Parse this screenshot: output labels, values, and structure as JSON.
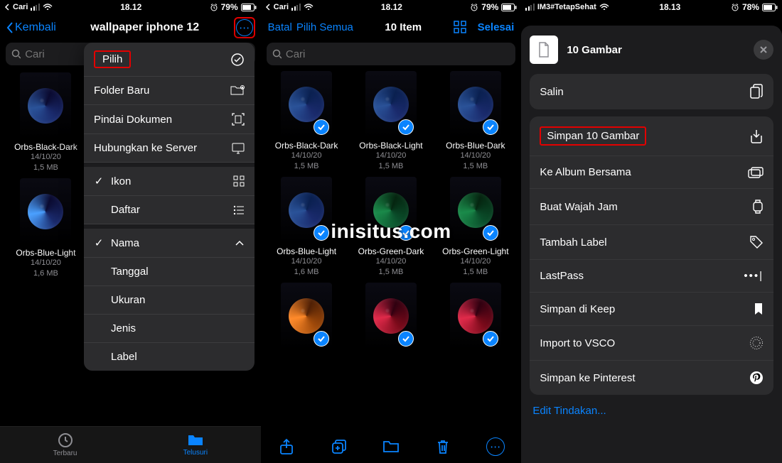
{
  "watermark": "inisitus.com",
  "screen1": {
    "status": {
      "carrier": "Cari",
      "time": "18.12",
      "battery": "79%"
    },
    "nav": {
      "back": "Kembali",
      "title": "wallpaper iphone 12"
    },
    "search": {
      "placeholder": "Cari"
    },
    "dropdown": {
      "select": "Pilih",
      "new_folder": "Folder Baru",
      "scan_doc": "Pindai Dokumen",
      "connect_server": "Hubungkan ke Server",
      "view_icons": "Ikon",
      "view_list": "Daftar",
      "sort_name": "Nama",
      "sort_date": "Tanggal",
      "sort_size": "Ukuran",
      "sort_kind": "Jenis",
      "sort_label": "Label"
    },
    "files": [
      {
        "name": "Orbs-Black-Dark",
        "date": "14/10/20",
        "size": "1,5 MB"
      },
      {
        "name": "Orbs-Blue-Light",
        "date": "14/10/20",
        "size": "1,6 MB"
      }
    ],
    "tabs": {
      "recent": "Terbaru",
      "browse": "Telusuri"
    }
  },
  "screen2": {
    "status": {
      "carrier": "Cari",
      "time": "18.12",
      "battery": "79%"
    },
    "nav": {
      "cancel": "Batal",
      "select_all": "Pilih Semua",
      "count": "10 Item",
      "done": "Selesai"
    },
    "search": {
      "placeholder": "Cari"
    },
    "files": [
      {
        "name": "Orbs-Black-Dark",
        "date": "14/10/20",
        "size": "1,5 MB",
        "c": "blue"
      },
      {
        "name": "Orbs-Black-Light",
        "date": "14/10/20",
        "size": "1,5 MB",
        "c": "blue"
      },
      {
        "name": "Orbs-Blue-Dark",
        "date": "14/10/20",
        "size": "1,5 MB",
        "c": "blue"
      },
      {
        "name": "Orbs-Blue-Light",
        "date": "14/10/20",
        "size": "1,6 MB",
        "c": "blue"
      },
      {
        "name": "Orbs-Green-Dark",
        "date": "14/10/20",
        "size": "1,5 MB",
        "c": "green"
      },
      {
        "name": "Orbs-Green-Light",
        "date": "14/10/20",
        "size": "1,5 MB",
        "c": "green"
      },
      {
        "name": "",
        "date": "",
        "size": "",
        "c": "orange"
      },
      {
        "name": "",
        "date": "",
        "size": "",
        "c": "red"
      },
      {
        "name": "",
        "date": "",
        "size": "",
        "c": "red"
      }
    ]
  },
  "screen3": {
    "status": {
      "carrier": "IM3#TetapSehat",
      "time": "18.13",
      "battery": "78%"
    },
    "sheet": {
      "title": "10 Gambar",
      "actions": {
        "copy": "Salin",
        "save_images": "Simpan 10 Gambar",
        "shared_album": "Ke Album Bersama",
        "watch_face": "Buat Wajah Jam",
        "add_tag": "Tambah Label",
        "lastpass": "LastPass",
        "keep": "Simpan di Keep",
        "vsco": "Import to VSCO",
        "pinterest": "Simpan ke Pinterest"
      },
      "edit": "Edit Tindakan..."
    }
  }
}
